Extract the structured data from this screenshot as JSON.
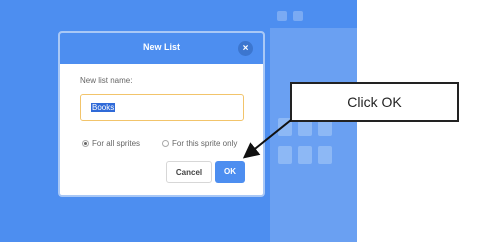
{
  "dialog": {
    "title": "New List",
    "close_icon": "×",
    "name_label": "New list name:",
    "name_value": "Books",
    "options": [
      {
        "label": "For all sprites",
        "selected": true
      },
      {
        "label": "For this sprite only",
        "selected": false
      }
    ],
    "cancel_label": "Cancel",
    "ok_label": "OK"
  },
  "annotation": {
    "text": "Click OK"
  },
  "colors": {
    "accent": "#4d8ef0",
    "input_highlight": "#f2c46b"
  }
}
